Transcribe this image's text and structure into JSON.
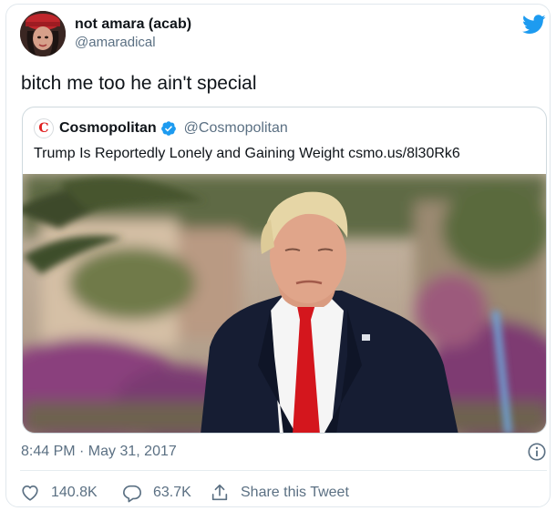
{
  "tweet": {
    "author": {
      "display_name": "not amara (acab)",
      "handle": "@amaradical"
    },
    "text": "bitch me too he ain't special",
    "timestamp": "8:44 PM · May 31, 2017",
    "stats": {
      "likes": "140.8K",
      "replies": "63.7K",
      "share_label": "Share this Tweet"
    }
  },
  "quoted": {
    "avatar_letter": "C",
    "display_name": "Cosmopolitan",
    "handle": "@Cosmopolitan",
    "text": "Trump Is Reportedly Lonely and Gaining Weight csmo.us/8l30Rk6"
  },
  "icons": {
    "brand": "twitter-bird-icon",
    "verified": "verified-badge-icon",
    "info": "info-icon",
    "like": "heart-icon",
    "reply": "reply-icon",
    "share": "share-icon"
  },
  "colors": {
    "twitter_blue": "#1d9bf0",
    "muted_text": "#5b7083",
    "cosmo_red": "#e02020"
  }
}
